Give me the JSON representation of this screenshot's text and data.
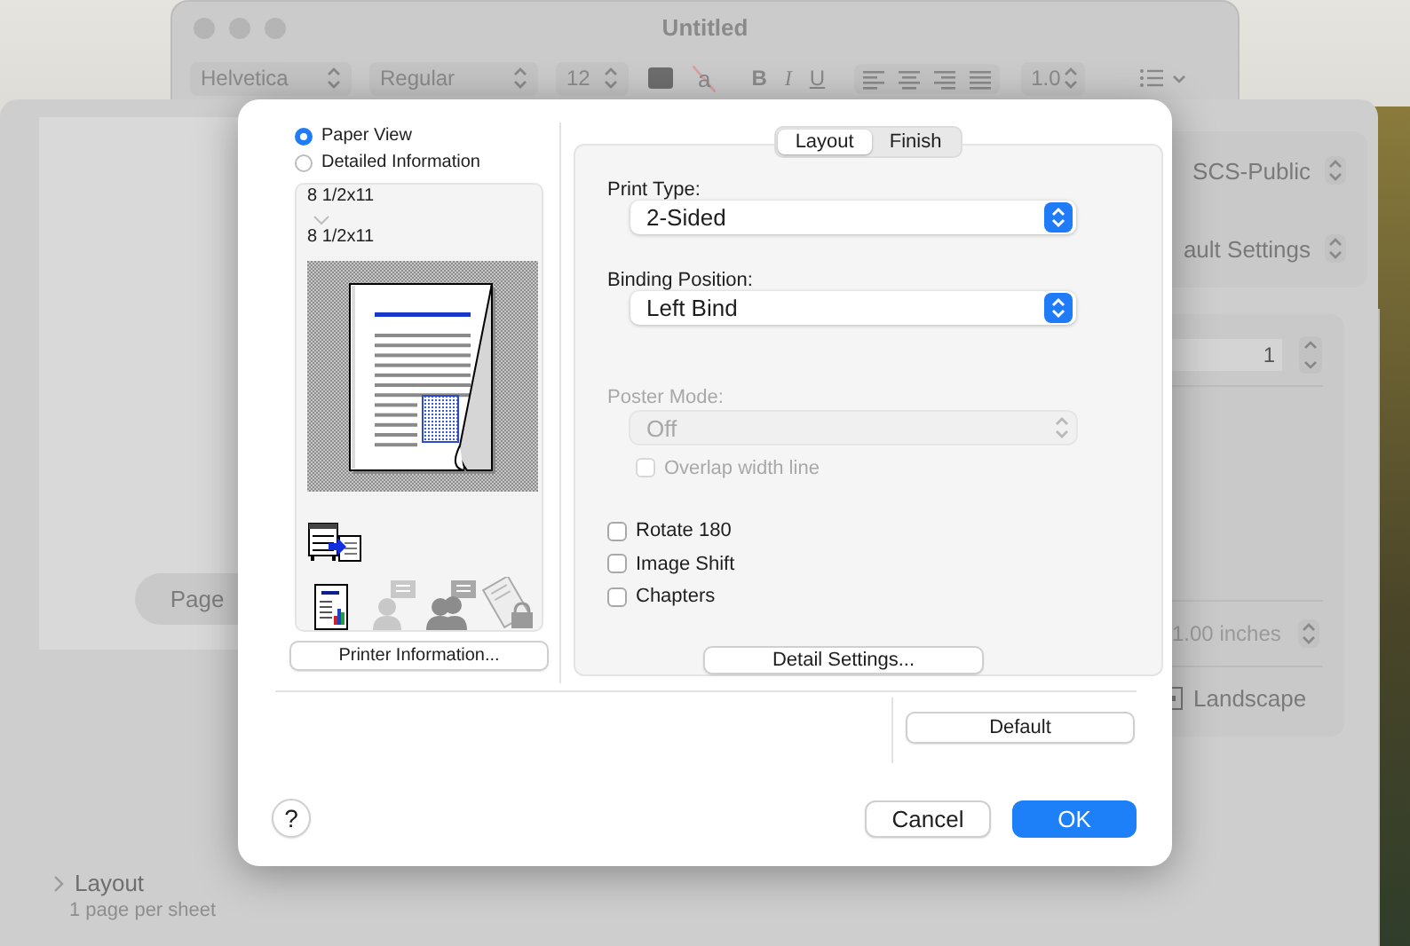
{
  "background_window": {
    "title": "Untitled",
    "toolbar": {
      "font_family": "Helvetica",
      "font_style": "Regular",
      "font_size": "12",
      "text_color_glyph": "a",
      "bold": "B",
      "italic": "I",
      "underline": "U",
      "line_spacing": "1.0"
    }
  },
  "print_panel": {
    "page_button": "Page",
    "printer": "SCS-Public",
    "presets": "ault Settings",
    "copies": "1",
    "margin": "1.00 inches",
    "orientation": "Landscape",
    "section": {
      "title": "Layout",
      "summary": "1 page per sheet",
      "expanded": false
    }
  },
  "dialog": {
    "view_options": [
      {
        "label": "Paper View",
        "selected": true
      },
      {
        "label": "Detailed Information",
        "selected": false
      }
    ],
    "preview": {
      "original_size": "8 1/2x11",
      "output_size": "8 1/2x11"
    },
    "printer_info_button": "Printer Information...",
    "tabs": [
      {
        "label": "Layout",
        "selected": true
      },
      {
        "label": "Finish",
        "selected": false
      }
    ],
    "fields": [
      {
        "label": "Print Type:",
        "value": "2-Sided",
        "disabled": false
      },
      {
        "label": "Binding Position:",
        "value": "Left Bind",
        "disabled": false
      },
      {
        "label": "Poster Mode:",
        "value": "Off",
        "disabled": true
      }
    ],
    "overlap": {
      "label": "Overlap width line",
      "checked": false,
      "disabled": true
    },
    "checkboxes": [
      {
        "label": "Rotate 180",
        "checked": false
      },
      {
        "label": "Image Shift",
        "checked": false
      },
      {
        "label": "Chapters",
        "checked": false
      }
    ],
    "detail_button": "Detail Settings...",
    "default_button": "Default",
    "help_button": "?",
    "cancel_button": "Cancel",
    "ok_button": "OK"
  }
}
